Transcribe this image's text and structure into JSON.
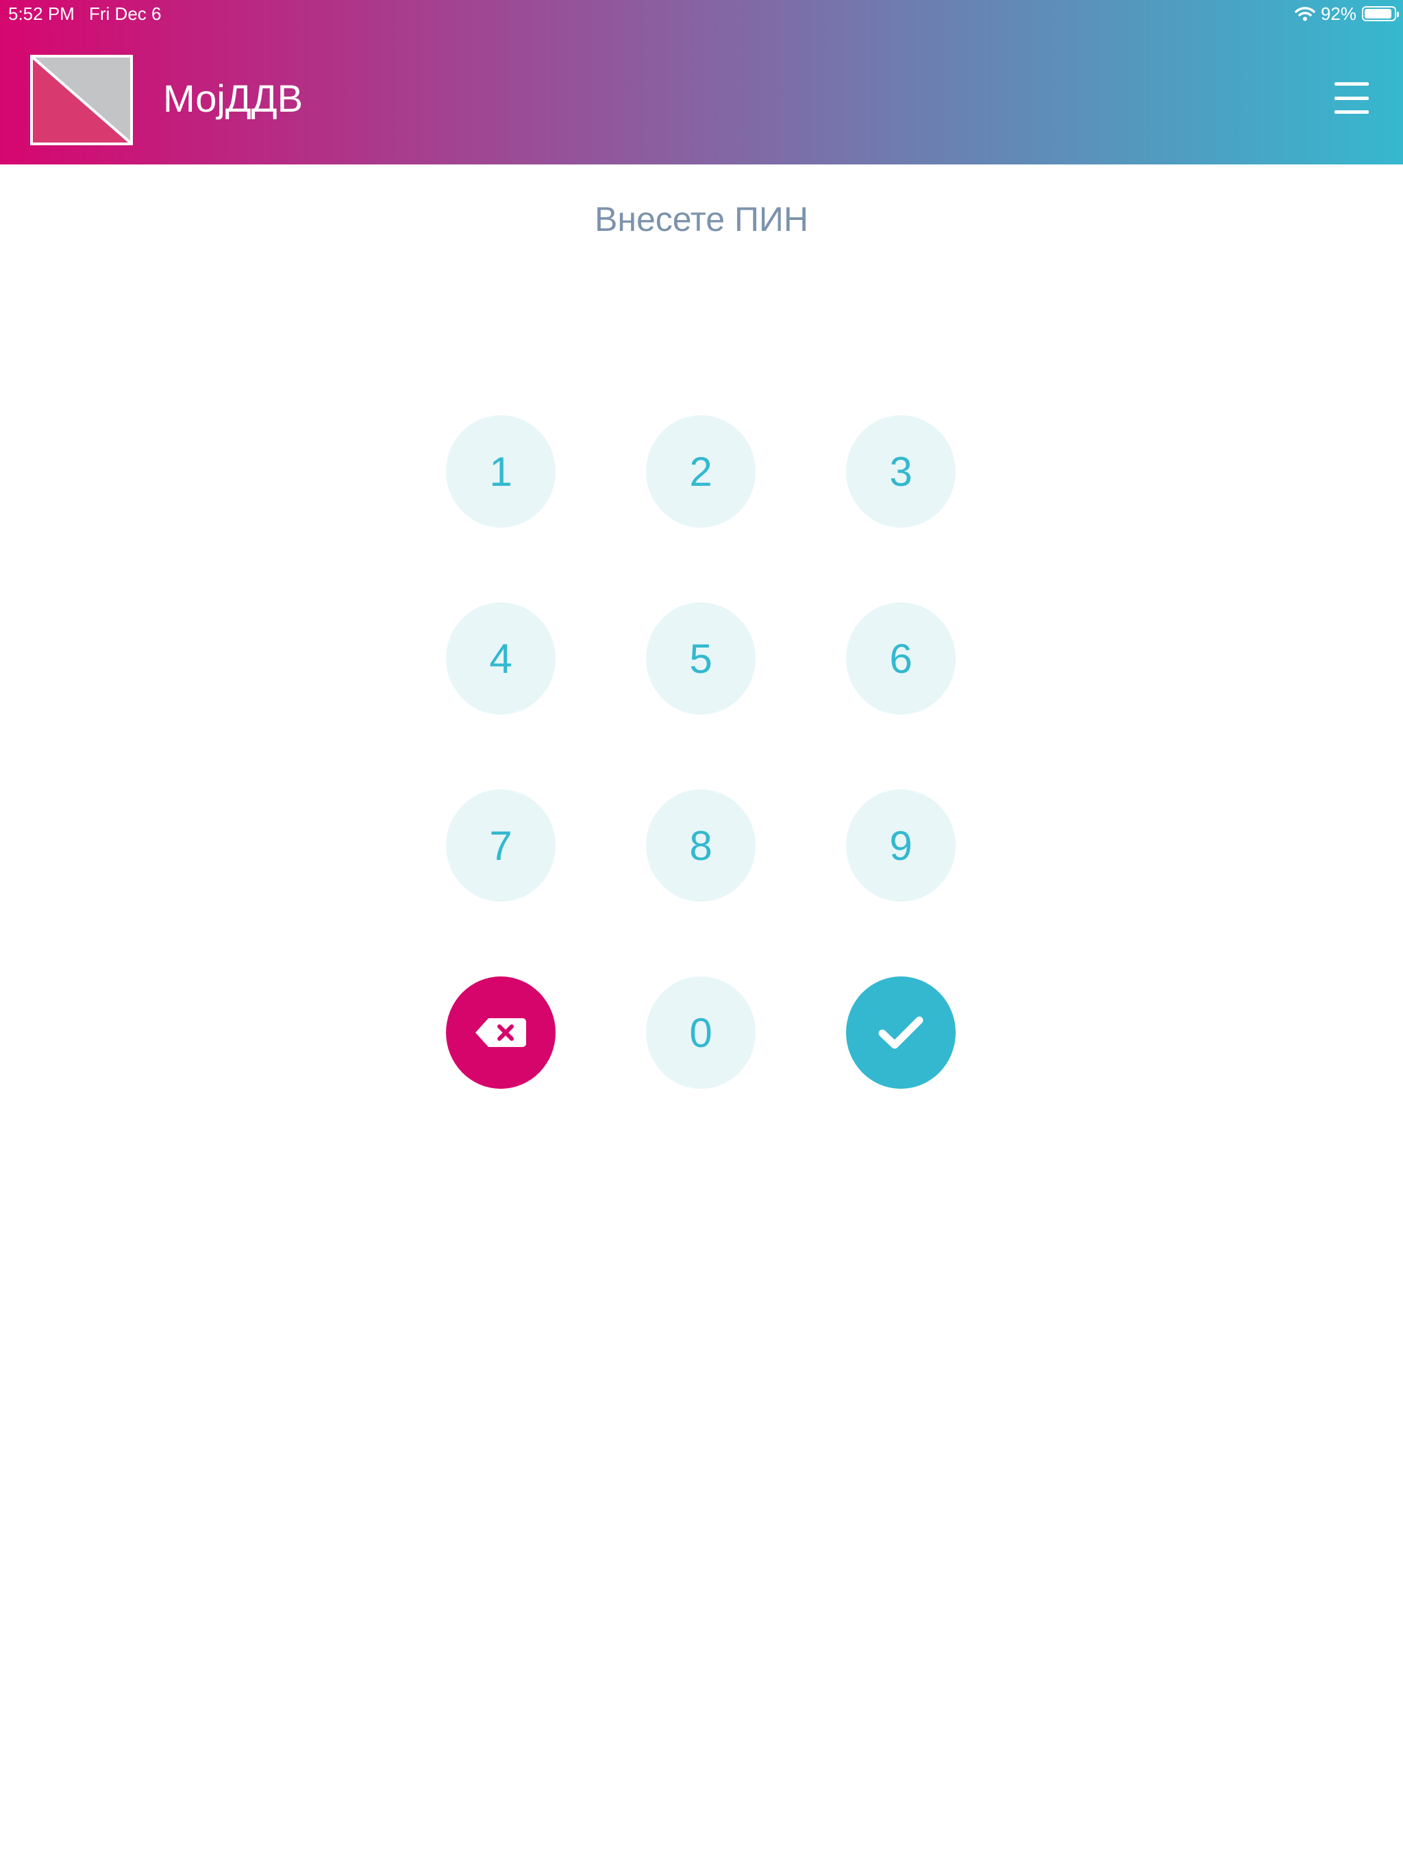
{
  "status_bar": {
    "time": "5:52 PM",
    "date": "Fri Dec 6",
    "battery": "92%",
    "battery_level": 0.92,
    "icons": [
      "wifi-icon",
      "battery-icon"
    ]
  },
  "header": {
    "title": "МојДДВ",
    "logo_icon": "app-logo-icon",
    "menu_icon": "hamburger-menu-icon",
    "gradient": [
      "#d6066f",
      "#8e5b9e",
      "#36b8cf"
    ]
  },
  "pin": {
    "prompt": "Внесете ПИН",
    "keys": [
      "1",
      "2",
      "3",
      "4",
      "5",
      "6",
      "7",
      "8",
      "9"
    ],
    "zero": "0",
    "delete_icon": "backspace-icon",
    "confirm_icon": "check-icon"
  },
  "colors": {
    "accent": "#33b8cf",
    "danger": "#d6056b",
    "key_background": "#e8f6f8",
    "prompt_text": "#7c93ab"
  }
}
